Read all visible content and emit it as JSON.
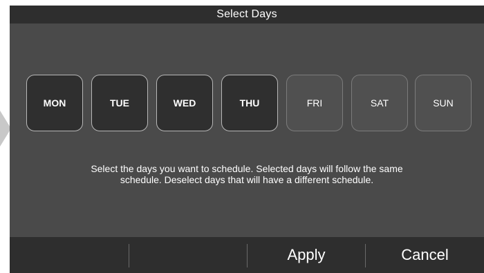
{
  "header": {
    "title": "Select Days"
  },
  "days": [
    {
      "label": "MON",
      "selected": true
    },
    {
      "label": "TUE",
      "selected": true
    },
    {
      "label": "WED",
      "selected": true
    },
    {
      "label": "THU",
      "selected": true
    },
    {
      "label": "FRI",
      "selected": false
    },
    {
      "label": "SAT",
      "selected": false
    },
    {
      "label": "SUN",
      "selected": false
    }
  ],
  "instructions": {
    "line1": "Select the days you want to schedule.  Selected days will follow the same",
    "line2": "schedule.  Deselect days that will have a different schedule."
  },
  "footer": {
    "apply_label": "Apply",
    "cancel_label": "Cancel"
  },
  "colors": {
    "background": "#4a4a4a",
    "bar": "#2e2e2e",
    "selected_button": "#2f2f2f",
    "unselected_button": "#505050",
    "text": "#ffffff"
  }
}
